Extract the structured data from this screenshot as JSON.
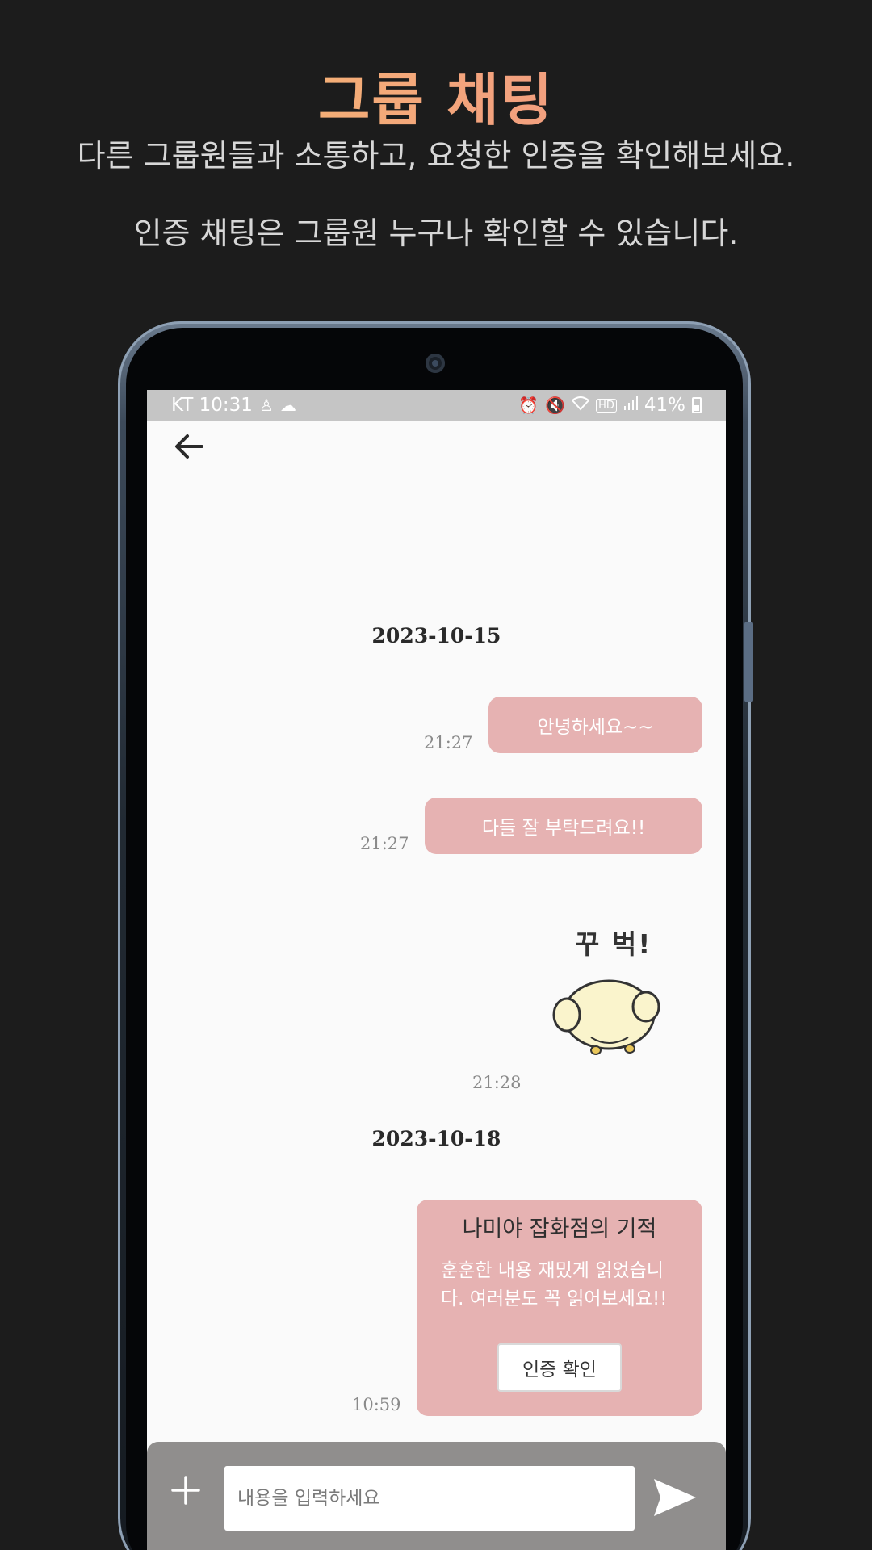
{
  "promo": {
    "title": "그룹 채팅",
    "line1": "다른 그룹원들과 소통하고, 요청한 인증을 확인해보세요.",
    "line2": "인증 채팅은 그룹원 누구나 확인할 수 있습니다."
  },
  "status_bar": {
    "carrier_time": "KT 10:31",
    "battery": "41%",
    "icons_left": [
      "person-notification-icon",
      "cloud-chat-icon"
    ],
    "icons_right": [
      "alarm-icon",
      "mute-icon",
      "wifi-icon",
      "hd-icon",
      "signal-icon",
      "battery-icon"
    ]
  },
  "chat": {
    "date1": "2023-10-15",
    "messages": [
      {
        "text": "안녕하세요~~",
        "time": "21:27"
      },
      {
        "text": "다들 잘 부탁드려요!!",
        "time": "21:27"
      }
    ],
    "sticker": {
      "caption": "꾸 벅!",
      "time": "21:28"
    },
    "date2": "2023-10-18",
    "cert": {
      "title": "나미야 잡화점의 기적",
      "body": "훈훈한 내용 재밌게 읽었습니다. 여러분도 꼭 읽어보세요!!",
      "button": "인증 확인",
      "time": "10:59"
    }
  },
  "input": {
    "placeholder": "내용을 입력하세요"
  },
  "colors": {
    "bubble": "#e6b2b2",
    "input_bar": "#908e8d",
    "background": "#1c1c1c"
  }
}
